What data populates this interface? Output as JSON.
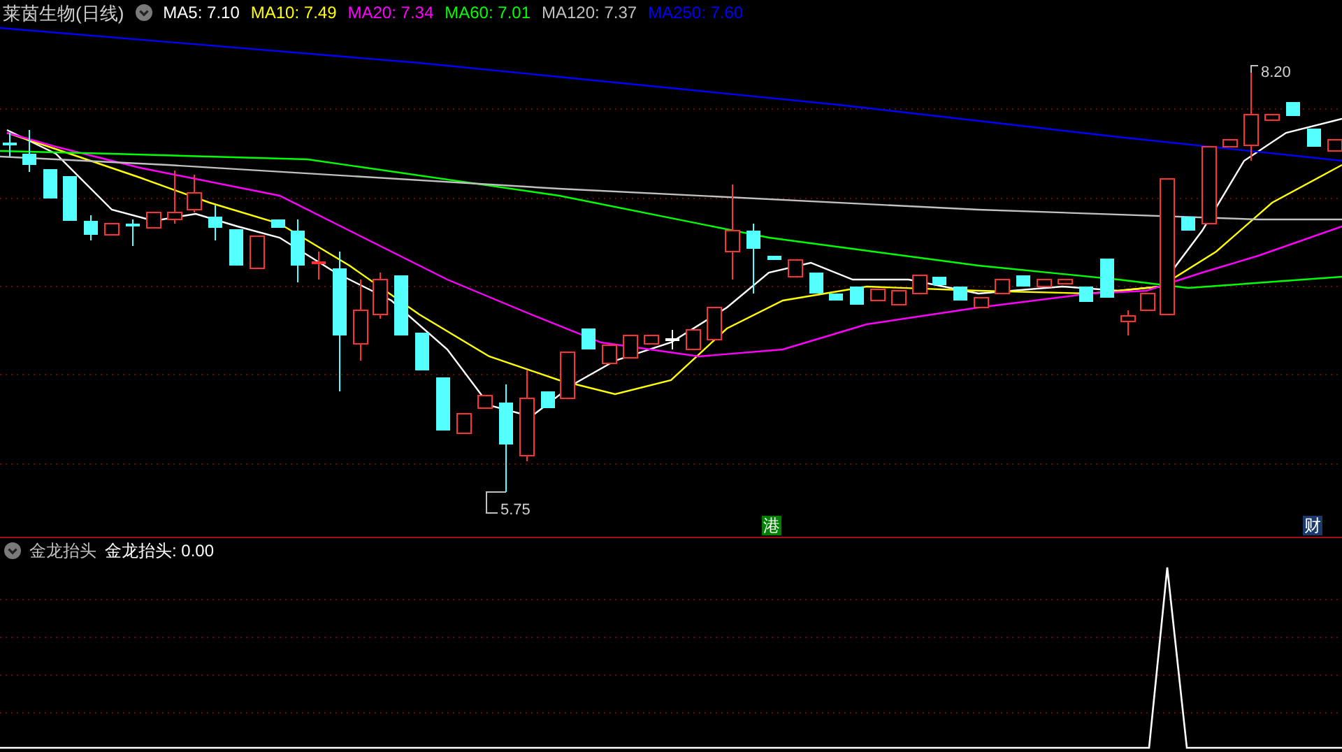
{
  "chart_title": "莱茵生物(日线)",
  "ma_legend": [
    {
      "label": "MA5: 7.10",
      "color": "#ffffff"
    },
    {
      "label": "MA10: 7.49",
      "color": "#ffff00"
    },
    {
      "label": "MA20: 7.34",
      "color": "#ff00ff"
    },
    {
      "label": "MA60: 7.01",
      "color": "#00ff00"
    },
    {
      "label": "MA120: 7.37",
      "color": "#c0c0c0"
    },
    {
      "label": "MA250: 7.60",
      "color": "#0000ff"
    }
  ],
  "price_markers": [
    {
      "kind": "low",
      "text": "5.75"
    },
    {
      "kind": "high",
      "text": "8.20"
    }
  ],
  "event_badges": [
    {
      "text": "港",
      "color": "#008000"
    },
    {
      "text": "财",
      "color": "#1a3a6e"
    }
  ],
  "indicator": {
    "name": "金龙抬头",
    "reading": "金龙抬头: 0.00"
  }
}
